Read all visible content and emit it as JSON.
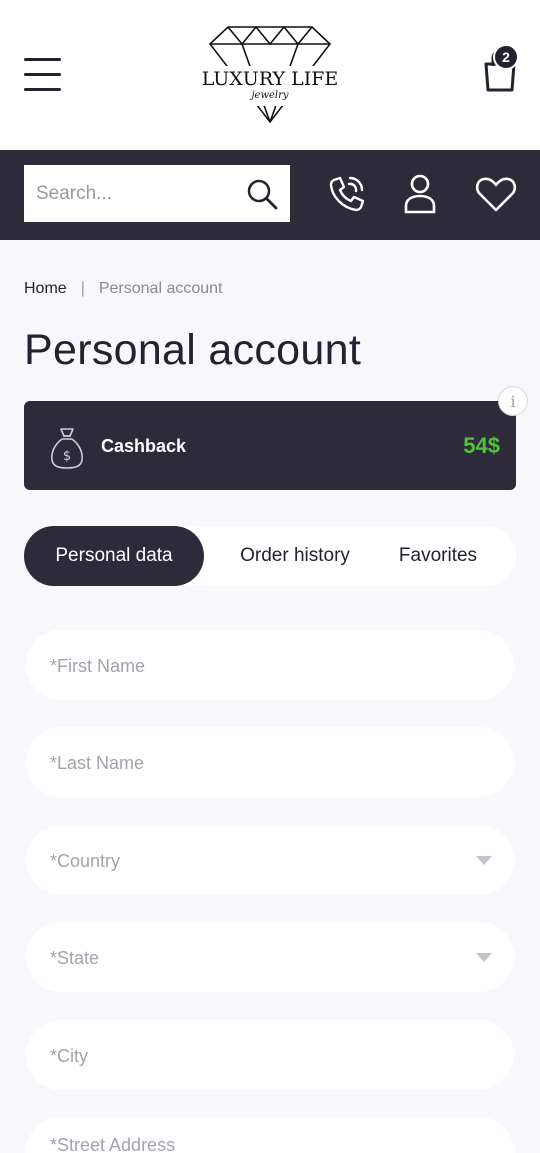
{
  "header": {
    "logo_title": "LUXURY LIFE",
    "logo_subtitle": "jewelry",
    "cart_count": "2"
  },
  "search": {
    "placeholder": "Search..."
  },
  "breadcrumb": {
    "home": "Home",
    "separator": "|",
    "current": "Personal account"
  },
  "page_title": "Personal account",
  "cashback": {
    "label": "Cashback",
    "value": "54$",
    "info": "i"
  },
  "tabs": [
    {
      "label": "Personal data",
      "active": true
    },
    {
      "label": "Order history",
      "active": false
    },
    {
      "label": "Favorites",
      "active": false
    }
  ],
  "form": {
    "first_name": "*First Name",
    "last_name": "*Last Name",
    "country": "*Country",
    "state": "*State",
    "city": "*City",
    "street": "*Street Address"
  },
  "colors": {
    "brand_dark": "#2d2b3a",
    "cashback_green": "#4fc43a",
    "page_bg": "#f8f7fc"
  }
}
